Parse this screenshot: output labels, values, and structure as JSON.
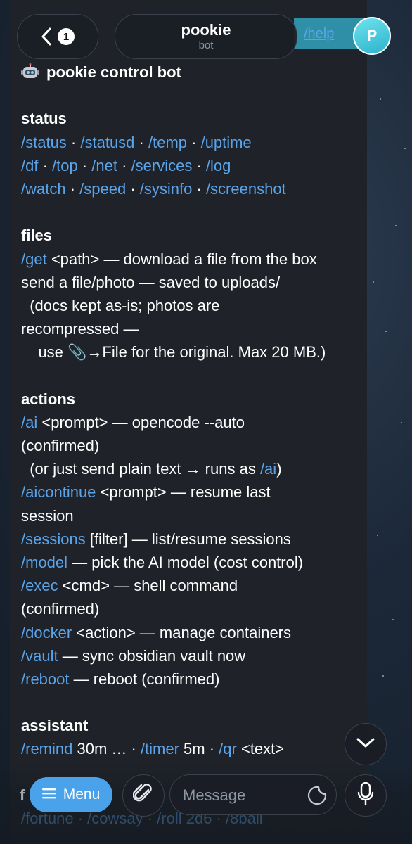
{
  "header": {
    "back_badge_count": "1",
    "chat_title": "pookie",
    "chat_subtitle": "bot",
    "help_chip": "/help",
    "avatar_letter": "P"
  },
  "message": {
    "title": "pookie control bot",
    "sections": {
      "status": {
        "heading": "status",
        "row1": [
          "/status",
          "/statusd",
          "/temp",
          "/uptime"
        ],
        "row2": [
          "/df",
          "/top",
          "/net",
          "/services",
          "/log"
        ],
        "row3": [
          "/watch",
          "/speed",
          "/sysinfo",
          "/screenshot"
        ],
        "sep": " · "
      },
      "files": {
        "heading": "files",
        "get_cmd": "/get",
        "get_text": " <path> — download a file from the box",
        "line2": "send a file/photo — saved to uploads/",
        "line3": "  (docs kept as-is; photos are",
        "line4": "recompressed —",
        "line5": "    use 📎→File for the original. Max 20 MB.)"
      },
      "actions": {
        "heading": "actions",
        "ai_cmd": "/ai",
        "ai_text": " <prompt> — opencode --auto",
        "ai_text2": "(confirmed)",
        "plain_text_a": "  (or just send plain text → runs as ",
        "plain_text_cmd": "/ai",
        "plain_text_b": ")",
        "aicontinue_cmd": "/aicontinue",
        "aicontinue_text": " <prompt> — resume last",
        "aicontinue_text2": "session",
        "sessions_cmd": "/sessions",
        "sessions_text": " [filter] — list/resume sessions",
        "model_cmd": "/model",
        "model_text": " — pick the AI model (cost control)",
        "exec_cmd": "/exec",
        "exec_text": " <cmd> — shell command",
        "exec_text2": "(confirmed)",
        "docker_cmd": "/docker",
        "docker_text": " <action> — manage containers",
        "vault_cmd": "/vault",
        "vault_text": " — sync obsidian vault now",
        "reboot_cmd": "/reboot",
        "reboot_text": " — reboot (confirmed)"
      },
      "assistant": {
        "heading": "assistant",
        "remind_cmd": "/remind",
        "remind_text": " 30m … · ",
        "timer_cmd": "/timer",
        "timer_text": " 5m · ",
        "qr_cmd": "/qr",
        "qr_text": " <text>"
      }
    }
  },
  "behind_bar": {
    "heading_initial": "f",
    "text": "/fortune · /cowsay · /roll 2d6 · /8ball"
  },
  "composer": {
    "menu_label": "Menu",
    "placeholder": "Message"
  },
  "colors": {
    "link": "#5aa4ea",
    "bubble": "#1f2229",
    "menu_button": "#4aa3ea"
  },
  "icons": [
    "back-chevron-icon",
    "robot-emoji-icon",
    "chevron-down-icon",
    "hamburger-icon",
    "paperclip-icon",
    "sticker-icon",
    "microphone-icon"
  ]
}
